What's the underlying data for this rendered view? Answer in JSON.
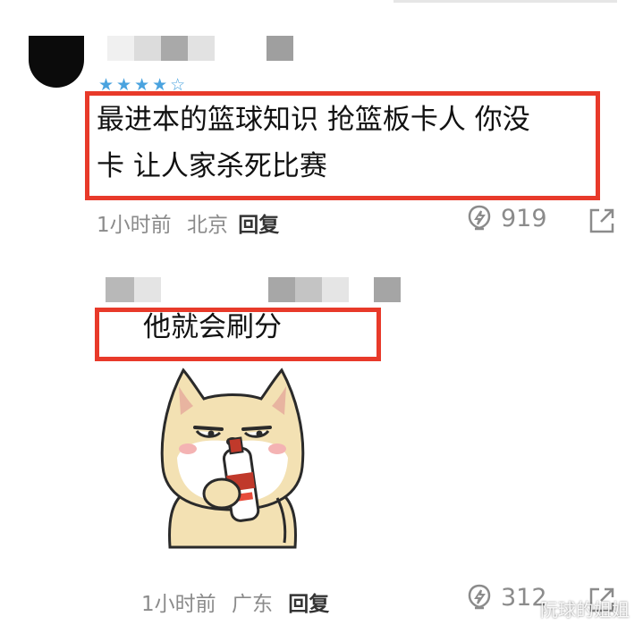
{
  "comments": [
    {
      "stars": "★★★★☆",
      "text_line1": "最进本的篮球知识 抢篮板卡人 你没",
      "text_line2": "卡 让人家杀死比赛",
      "time": "1小时前",
      "location": "北京",
      "reply_label": "回复",
      "likes": "919"
    },
    {
      "text": "他就会刷分",
      "time": "1小时前",
      "location": "广东",
      "reply_label": "回复",
      "likes": "312"
    }
  ],
  "sticker": {
    "icon": "shiba-dog-drinking-sticker"
  },
  "watermark": "阮球的姐姐",
  "colors": {
    "highlight_box": "#e83a2a",
    "meta_gray": "#8b8b8b",
    "stars": "#4aa3df"
  }
}
